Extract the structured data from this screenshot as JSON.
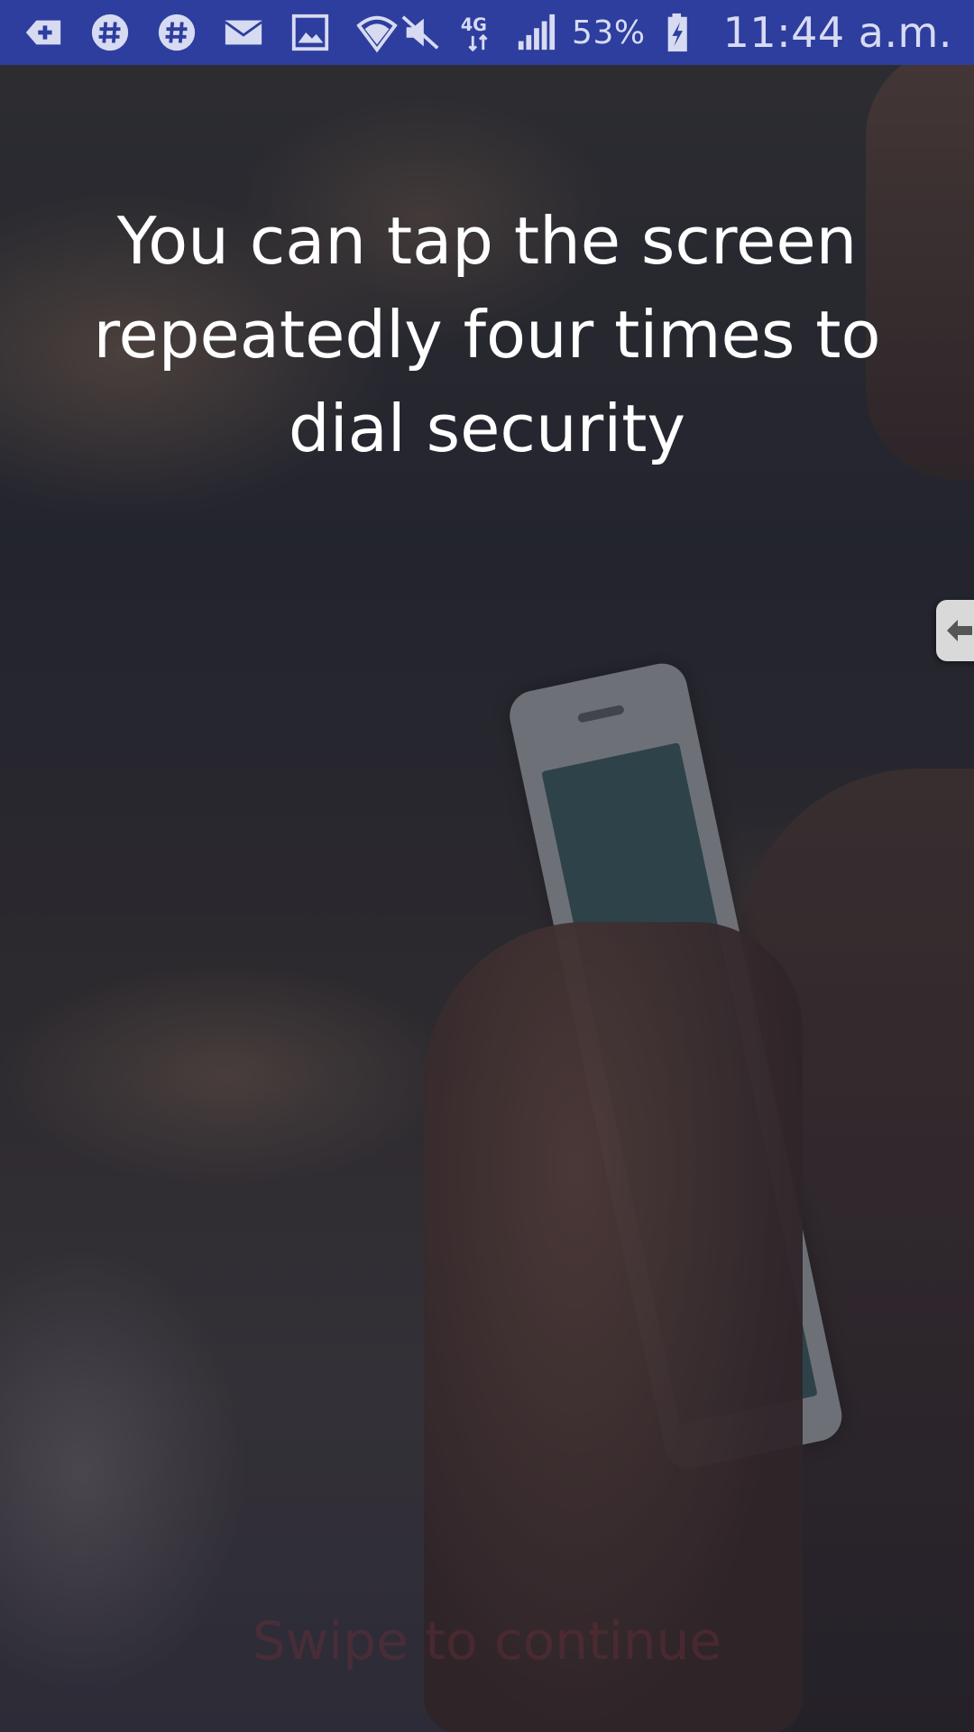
{
  "status_bar": {
    "left_icons": [
      "add-icon",
      "hashtag-icon",
      "hashtag-icon",
      "mail-icon",
      "image-icon",
      "wifi-icon"
    ],
    "right_icons": [
      "mute-icon",
      "network-4g-icon",
      "signal-icon",
      "battery-charging-icon"
    ],
    "network_label": "4G",
    "battery": "53%",
    "time": "11:44 a.m."
  },
  "main": {
    "message": "You can tap the screen repeatedly four times to dial security",
    "swipe_hint": "Swipe to continue"
  },
  "colors": {
    "status_bar_bg": "#2e3e9e",
    "message_text": "#ffffff"
  }
}
